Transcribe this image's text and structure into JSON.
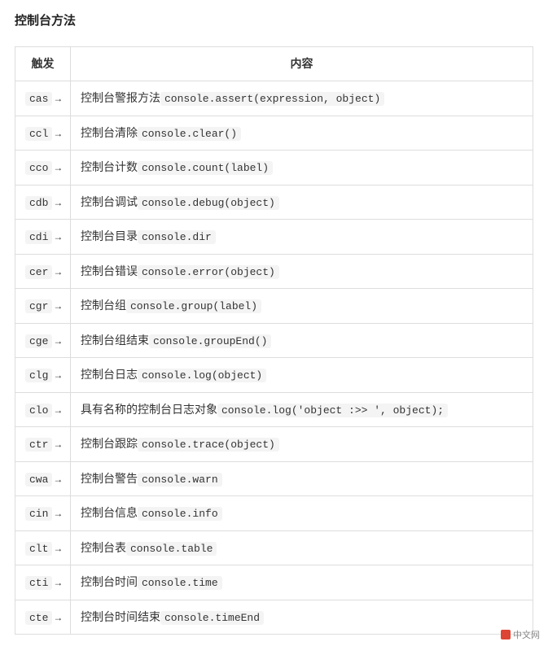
{
  "heading": "控制台方法",
  "table": {
    "headers": {
      "trigger": "触发",
      "content": "内容"
    },
    "rows": [
      {
        "trig": "cas",
        "label": "控制台警报方法",
        "code": "console.assert(expression, object)"
      },
      {
        "trig": "ccl",
        "label": "控制台清除",
        "code": "console.clear()"
      },
      {
        "trig": "cco",
        "label": "控制台计数",
        "code": "console.count(label)"
      },
      {
        "trig": "cdb",
        "label": "控制台调试",
        "code": "console.debug(object)"
      },
      {
        "trig": "cdi",
        "label": "控制台目录",
        "code": "console.dir"
      },
      {
        "trig": "cer",
        "label": "控制台错误",
        "code": "console.error(object)"
      },
      {
        "trig": "cgr",
        "label": "控制台组",
        "code": "console.group(label)"
      },
      {
        "trig": "cge",
        "label": "控制台组结束",
        "code": "console.groupEnd()"
      },
      {
        "trig": "clg",
        "label": "控制台日志",
        "code": "console.log(object)"
      },
      {
        "trig": "clo",
        "label": "具有名称的控制台日志对象",
        "code": "console.log('object :>> ', object);"
      },
      {
        "trig": "ctr",
        "label": "控制台跟踪",
        "code": "console.trace(object)"
      },
      {
        "trig": "cwa",
        "label": "控制台警告",
        "code": "console.warn"
      },
      {
        "trig": "cin",
        "label": "控制台信息",
        "code": "console.info"
      },
      {
        "trig": "clt",
        "label": "控制台表",
        "code": "console.table"
      },
      {
        "trig": "cti",
        "label": "控制台时间",
        "code": "console.time"
      },
      {
        "trig": "cte",
        "label": "控制台时间结束",
        "code": "console.timeEnd"
      }
    ]
  },
  "watermark": "中文网"
}
